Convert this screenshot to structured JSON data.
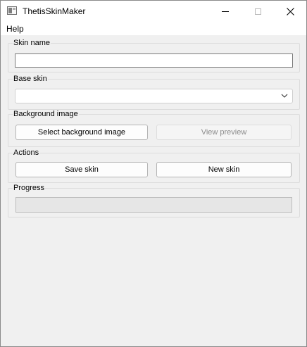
{
  "window": {
    "title": "ThetisSkinMaker"
  },
  "menu": {
    "items": [
      "Help"
    ]
  },
  "skin_name": {
    "label": "Skin name",
    "value": ""
  },
  "base_skin": {
    "label": "Base skin",
    "selected": ""
  },
  "background_image": {
    "label": "Background image",
    "select_button": "Select background image",
    "preview_button": "View preview",
    "preview_enabled": false
  },
  "actions": {
    "label": "Actions",
    "save_button": "Save skin",
    "new_button": "New skin"
  },
  "progress": {
    "label": "Progress",
    "value": 0
  },
  "icons": {
    "app": "app-icon",
    "minimize": "minimize-icon",
    "maximize": "maximize-icon",
    "close": "close-icon",
    "dropdown": "chevron-down-icon"
  },
  "colors": {
    "background": "#f0f0f0",
    "progress_fill": "#06b025"
  }
}
